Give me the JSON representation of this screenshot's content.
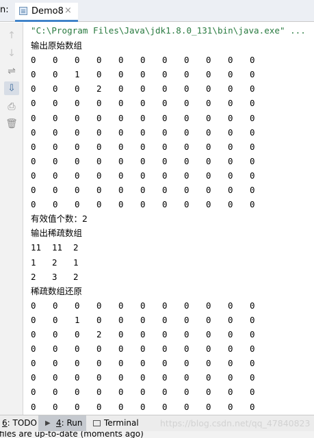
{
  "tabbar": {
    "prefix": "n:",
    "tab_label": "Demo8",
    "close_glyph": "×",
    "icon": "java-class-icon"
  },
  "gutter": [
    {
      "name": "rerun-up-icon",
      "glyph": "↑",
      "state": "dim"
    },
    {
      "name": "rerun-down-icon",
      "glyph": "↓",
      "state": "dim"
    },
    {
      "name": "soft-wrap-icon",
      "glyph": "⇌",
      "state": "normal"
    },
    {
      "name": "scroll-to-end-icon",
      "glyph": "⇩",
      "state": "active"
    },
    {
      "name": "print-icon",
      "glyph": "⎙",
      "state": "normal"
    },
    {
      "name": "trash-icon",
      "glyph": "🗑",
      "state": "normal"
    }
  ],
  "console": {
    "command": "\"C:\\Program Files\\Java\\jdk1.8.0_131\\bin\\java.exe\" ...",
    "label_original": "输出原始数组",
    "original": [
      [
        "0",
        "0",
        "0",
        "0",
        "0",
        "0",
        "0",
        "0",
        "0",
        "0",
        "0"
      ],
      [
        "0",
        "0",
        "1",
        "0",
        "0",
        "0",
        "0",
        "0",
        "0",
        "0",
        "0"
      ],
      [
        "0",
        "0",
        "0",
        "2",
        "0",
        "0",
        "0",
        "0",
        "0",
        "0",
        "0"
      ],
      [
        "0",
        "0",
        "0",
        "0",
        "0",
        "0",
        "0",
        "0",
        "0",
        "0",
        "0"
      ],
      [
        "0",
        "0",
        "0",
        "0",
        "0",
        "0",
        "0",
        "0",
        "0",
        "0",
        "0"
      ],
      [
        "0",
        "0",
        "0",
        "0",
        "0",
        "0",
        "0",
        "0",
        "0",
        "0",
        "0"
      ],
      [
        "0",
        "0",
        "0",
        "0",
        "0",
        "0",
        "0",
        "0",
        "0",
        "0",
        "0"
      ],
      [
        "0",
        "0",
        "0",
        "0",
        "0",
        "0",
        "0",
        "0",
        "0",
        "0",
        "0"
      ],
      [
        "0",
        "0",
        "0",
        "0",
        "0",
        "0",
        "0",
        "0",
        "0",
        "0",
        "0"
      ],
      [
        "0",
        "0",
        "0",
        "0",
        "0",
        "0",
        "0",
        "0",
        "0",
        "0",
        "0"
      ],
      [
        "0",
        "0",
        "0",
        "0",
        "0",
        "0",
        "0",
        "0",
        "0",
        "0",
        "0"
      ]
    ],
    "label_count": "有效值个数：2",
    "label_sparse": "输出稀疏数组",
    "sparse": [
      [
        "11",
        "11",
        "2"
      ],
      [
        "1",
        "2",
        "1"
      ],
      [
        "2",
        "3",
        "2"
      ]
    ],
    "label_restore": "稀疏数组还原",
    "restored": [
      [
        "0",
        "0",
        "0",
        "0",
        "0",
        "0",
        "0",
        "0",
        "0",
        "0",
        "0"
      ],
      [
        "0",
        "0",
        "1",
        "0",
        "0",
        "0",
        "0",
        "0",
        "0",
        "0",
        "0"
      ],
      [
        "0",
        "0",
        "0",
        "2",
        "0",
        "0",
        "0",
        "0",
        "0",
        "0",
        "0"
      ],
      [
        "0",
        "0",
        "0",
        "0",
        "0",
        "0",
        "0",
        "0",
        "0",
        "0",
        "0"
      ],
      [
        "0",
        "0",
        "0",
        "0",
        "0",
        "0",
        "0",
        "0",
        "0",
        "0",
        "0"
      ],
      [
        "0",
        "0",
        "0",
        "0",
        "0",
        "0",
        "0",
        "0",
        "0",
        "0",
        "0"
      ],
      [
        "0",
        "0",
        "0",
        "0",
        "0",
        "0",
        "0",
        "0",
        "0",
        "0",
        "0"
      ],
      [
        "0",
        "0",
        "0",
        "0",
        "0",
        "0",
        "0",
        "0",
        "0",
        "0",
        "0"
      ]
    ]
  },
  "bottombar": {
    "todo_num": "6",
    "todo_label": ": TODO",
    "run_num": "4",
    "run_label": ": Run",
    "terminal_label": "Terminal",
    "watermark": "https://blog.csdn.net/qq_47840823"
  },
  "status": "files are up-to-date (moments ago)"
}
